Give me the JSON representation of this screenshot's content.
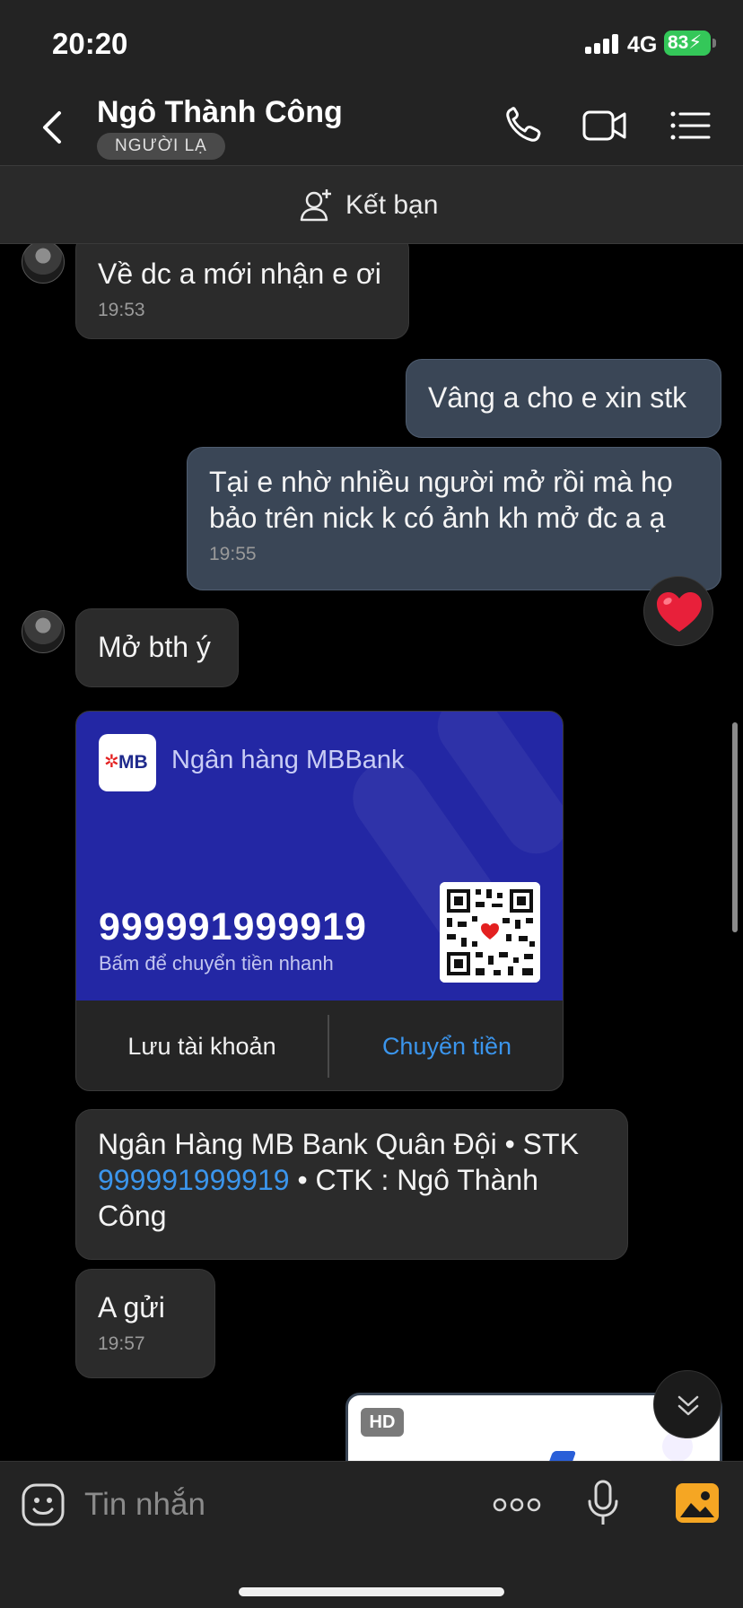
{
  "status_bar": {
    "time": "20:20",
    "network": "4G",
    "battery": "83"
  },
  "header": {
    "contact_name": "Ngô Thành Công",
    "badge": "NGƯỜI LẠ",
    "icons": [
      "back-chevron-icon",
      "phone-icon",
      "video-call-icon",
      "menu-list-icon"
    ]
  },
  "add_friend": {
    "label": "Kết bạn",
    "icon": "add-person-icon"
  },
  "messages": [
    {
      "dir": "in",
      "text": "Về dc a mới nhận e ơi",
      "time": "19:53"
    },
    {
      "dir": "out",
      "text": "Vâng a cho e xin stk"
    },
    {
      "dir": "out",
      "text_line1": "Tại e nhờ nhiều người mở rồi mà họ",
      "text_line2": "bảo trên nick k có ảnh kh mở đc  a ạ",
      "time": "19:55"
    },
    {
      "dir": "in",
      "text": "Mở bth ý"
    },
    {
      "dir": "in",
      "text_part1": "Ngân Hàng MB Bank Quân Đội • STK",
      "account_link": "999991999919",
      "text_part2": " • CTK : Ngô Thành",
      "text_part3": "Công"
    },
    {
      "dir": "in",
      "text": "A gửi",
      "time": "19:57"
    }
  ],
  "reaction": {
    "icon": "heart-icon",
    "color": "#e8203a"
  },
  "bank_card": {
    "logo_text": "MB",
    "bank_name": "Ngân hàng MBBank",
    "account_number": "999991999919",
    "subtitle": "Bấm để chuyển tiền nhanh",
    "save_button": "Lưu tài khoản",
    "transfer_button": "Chuyển tiền",
    "card_color": "#2327a4",
    "transfer_color": "#3b95ec"
  },
  "image_preview": {
    "badge": "HD"
  },
  "input_bar": {
    "placeholder": "Tin nhắn",
    "icons": [
      "sticker-icon",
      "more-icon",
      "microphone-icon",
      "gallery-icon"
    ],
    "gallery_color": "#f5a623"
  }
}
